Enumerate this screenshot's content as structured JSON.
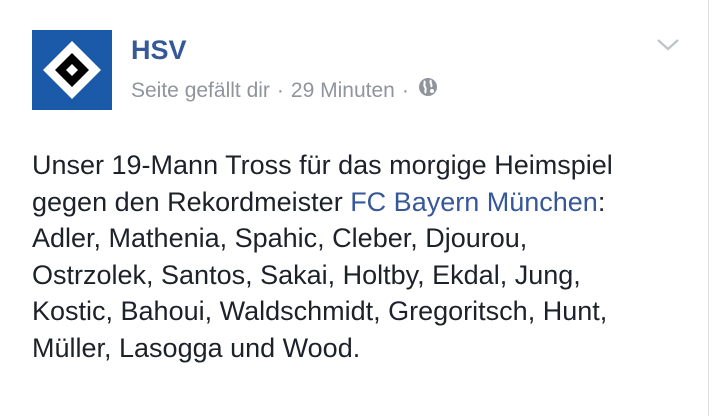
{
  "post": {
    "page_name": "HSV",
    "like_status": "Seite gefällt dir",
    "separator": "·",
    "timestamp": "29 Minuten",
    "privacy_icon": "globe-icon",
    "options_icon": "chevron-down-icon",
    "avatar_icon": "hsv-diamond-logo",
    "text": {
      "line1": "Unser 19-Mann Tross für das morgige Heimspiel",
      "line2_prefix": "gegen den Rekordmeister ",
      "mention": "FC Bayern München",
      "line2_suffix": ":",
      "line3": "Adler, Mathenia, Spahic, Cleber, Djourou,",
      "line4": "Ostrzolek, Santos, Sakai, Holtby, Ekdal, Jung,",
      "line5": "Kostic, Bahoui, Waldschmidt, Gregoritsch, Hunt,",
      "line6": "Müller, Lasogga und Wood."
    }
  },
  "colors": {
    "link": "#365899",
    "meta": "#90949c",
    "text": "#1d2129",
    "avatar_bg": "#1a5aa8"
  }
}
